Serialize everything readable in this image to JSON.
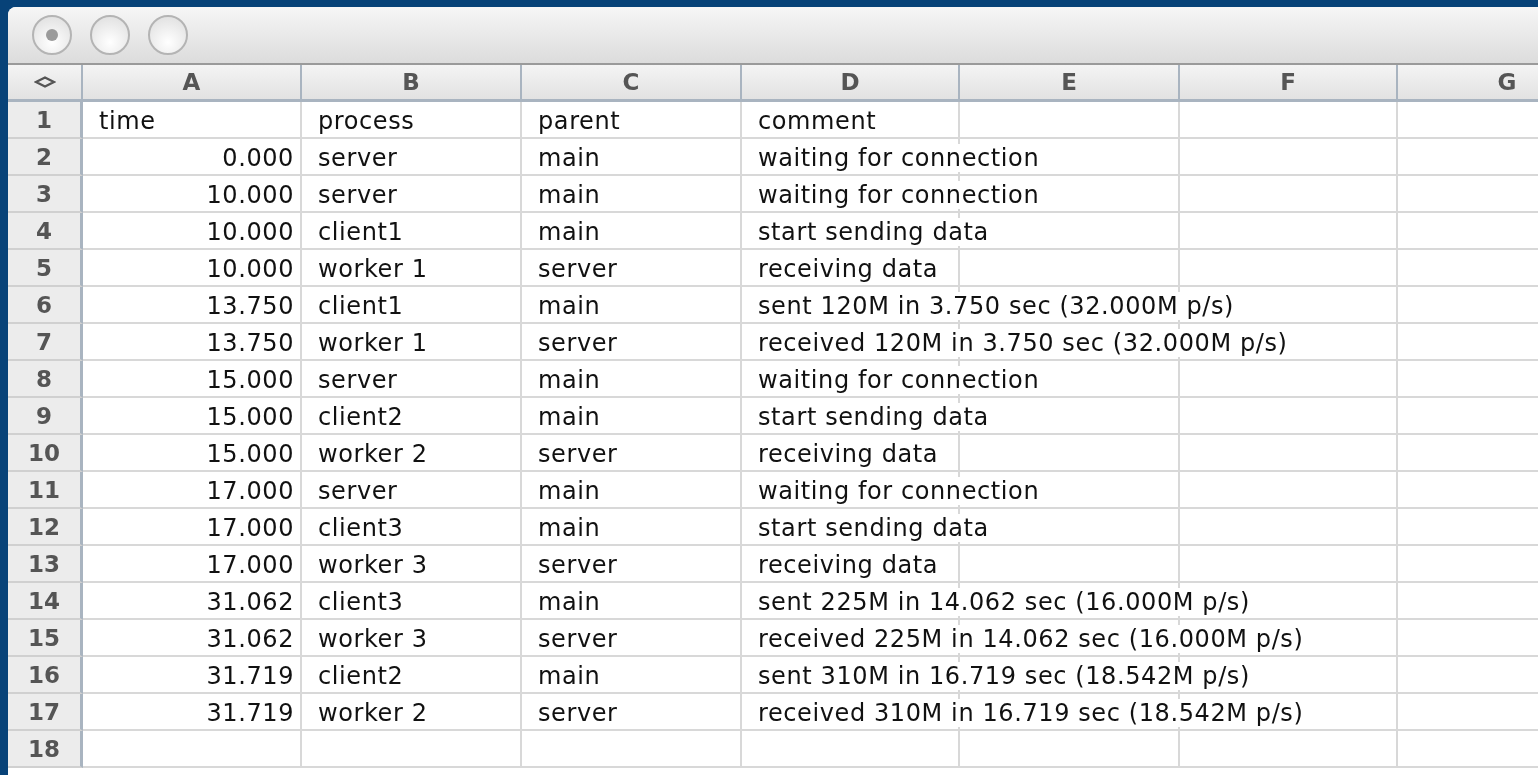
{
  "window": {
    "unsaved_changes": true
  },
  "columns": [
    "A",
    "B",
    "C",
    "D",
    "E",
    "F",
    "G"
  ],
  "rows": [
    {
      "number": "1",
      "cells": [
        "time",
        "process",
        "parent",
        "comment"
      ]
    },
    {
      "number": "2",
      "cells": [
        "0.000",
        "server",
        "main",
        "waiting for connection"
      ]
    },
    {
      "number": "3",
      "cells": [
        "10.000",
        "server",
        "main",
        "waiting for connection"
      ]
    },
    {
      "number": "4",
      "cells": [
        "10.000",
        "client1",
        "main",
        "start sending data"
      ]
    },
    {
      "number": "5",
      "cells": [
        "10.000",
        "worker 1",
        "server",
        "receiving data"
      ]
    },
    {
      "number": "6",
      "cells": [
        "13.750",
        "client1",
        "main",
        "sent 120M in 3.750 sec (32.000M p/s)"
      ]
    },
    {
      "number": "7",
      "cells": [
        "13.750",
        "worker 1",
        "server",
        "received 120M in 3.750 sec (32.000M p/s)"
      ]
    },
    {
      "number": "8",
      "cells": [
        "15.000",
        "server",
        "main",
        "waiting for connection"
      ]
    },
    {
      "number": "9",
      "cells": [
        "15.000",
        "client2",
        "main",
        "start sending data"
      ]
    },
    {
      "number": "10",
      "cells": [
        "15.000",
        "worker 2",
        "server",
        "receiving data"
      ]
    },
    {
      "number": "11",
      "cells": [
        "17.000",
        "server",
        "main",
        "waiting for connection"
      ]
    },
    {
      "number": "12",
      "cells": [
        "17.000",
        "client3",
        "main",
        "start sending data"
      ]
    },
    {
      "number": "13",
      "cells": [
        "17.000",
        "worker 3",
        "server",
        "receiving data"
      ]
    },
    {
      "number": "14",
      "cells": [
        "31.062",
        "client3",
        "main",
        "sent 225M in 14.062 sec (16.000M p/s)"
      ]
    },
    {
      "number": "15",
      "cells": [
        "31.062",
        "worker 3",
        "server",
        "received 225M in 14.062 sec (16.000M p/s)"
      ]
    },
    {
      "number": "16",
      "cells": [
        "31.719",
        "client2",
        "main",
        "sent 310M in 16.719 sec (18.542M p/s)"
      ]
    },
    {
      "number": "17",
      "cells": [
        "31.719",
        "worker 2",
        "server",
        "received 310M in 16.719 sec (18.542M p/s)"
      ]
    },
    {
      "number": "18",
      "cells": []
    }
  ]
}
